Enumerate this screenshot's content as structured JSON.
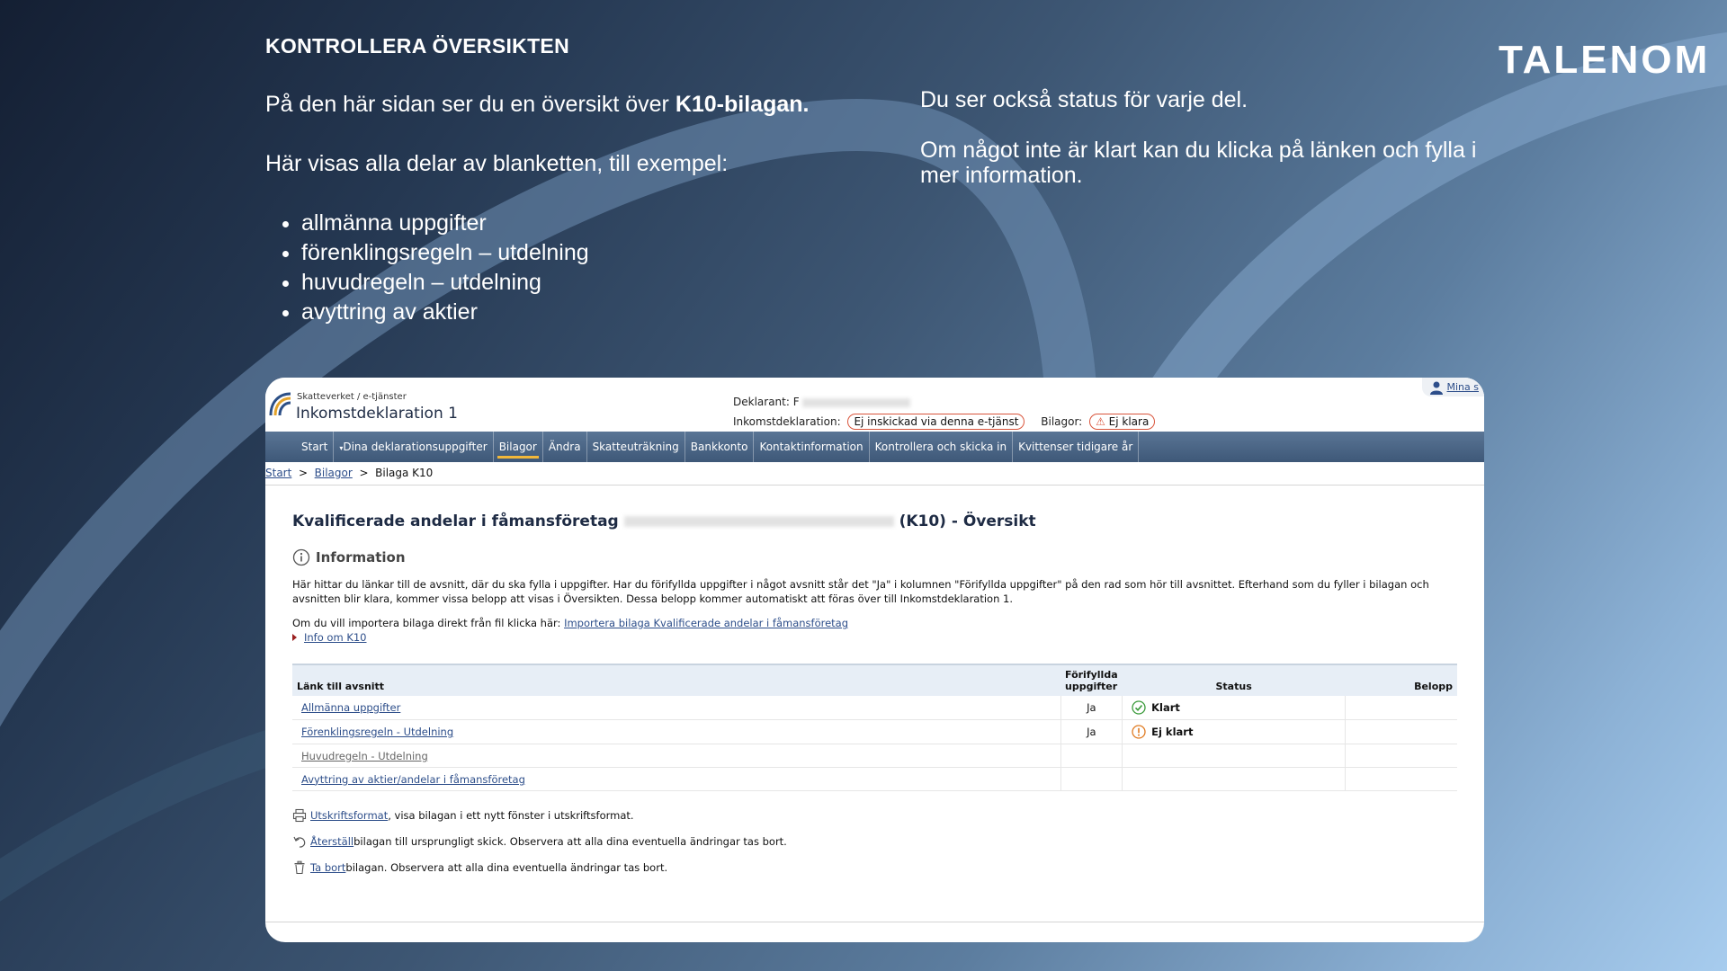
{
  "slide": {
    "title": "KONTROLLERA ÖVERSIKTEN",
    "logo": "TALENOM",
    "intro_prefix": "På den här sidan ser du en översikt över ",
    "intro_bold": "K10-bilagan.",
    "parts_intro": "Här visas alla delar av blanketten, till exempel:",
    "bullets": [
      "allmänna uppgifter",
      "förenklingsregeln – utdelning",
      "huvudregeln – utdelning",
      "avyttring av aktier"
    ],
    "right_p1": "Du ser också status för varje del.",
    "right_p2": "Om något inte är klart kan du klicka på länken och fylla i mer information."
  },
  "app": {
    "agency": "Skatteverket / e-tjänster",
    "title": "Inkomstdeklaration 1",
    "declarant_label": "Deklarant:",
    "declarant_value_visible": "F",
    "income_decl_label": "Inkomstdeklaration:",
    "income_decl_status": "Ej inskickad via denna e-tjänst",
    "attachments_label": "Bilagor:",
    "attachments_status": "Ej klara",
    "user_link": "Mina s",
    "nav": [
      "Start",
      "Dina deklarationsuppgifter",
      "Bilagor",
      "Ändra",
      "Skatteuträkning",
      "Bankkonto",
      "Kontaktinformation",
      "Kontrollera och skicka in",
      "Kvittenser tidigare år"
    ],
    "breadcrumb": [
      "Start",
      "Bilagor",
      "Bilaga K10"
    ],
    "page_title_prefix": "Kvalificerade andelar i fåmansföretag",
    "page_title_suffix": "(K10) - Översikt",
    "info_heading": "Information",
    "info_text": "Här hittar du länkar till de avsnitt, där du ska fylla i uppgifter. Har du förifyllda uppgifter i något avsnitt står det \"Ja\" i kolumnen \"Förifyllda uppgifter\" på den rad som hör till avsnittet. Efterhand som du fyller i bilagan och avsnitten blir klara, kommer vissa belopp att visas i Översikten. Dessa belopp kommer automatiskt att föras över till Inkomstdeklaration 1.",
    "import_prefix": "Om du vill importera bilaga direkt från fil klicka här: ",
    "import_link": "Importera bilaga Kvalificerade andelar i fåmansföretag",
    "info_k10": "Info om K10",
    "table": {
      "headers": [
        "Länk till avsnitt",
        "Förifyllda uppgifter",
        "Status",
        "Belopp"
      ],
      "rows": [
        {
          "link": "Allmänna uppgifter",
          "prefilled": "Ja",
          "status": "Klart",
          "amount": ""
        },
        {
          "link": "Förenklingsregeln - Utdelning",
          "prefilled": "Ja",
          "status": "Ej klart",
          "amount": ""
        },
        {
          "link": "Huvudregeln - Utdelning",
          "prefilled": "",
          "status": "",
          "amount": ""
        },
        {
          "link": "Avyttring av aktier/andelar i fåmansföretag",
          "prefilled": "",
          "status": "",
          "amount": ""
        }
      ]
    },
    "actions": [
      {
        "link": "Utskriftsformat",
        "text": ", visa bilagan i ett nytt fönster i utskriftsformat."
      },
      {
        "link": "Återställ",
        "text": " bilagan till ursprungligt skick. Observera att alla dina eventuella ändringar tas bort."
      },
      {
        "link": "Ta bort",
        "text": " bilagan. Observera att alla dina eventuella ändringar tas bort."
      }
    ]
  },
  "colors": {
    "accent_orange": "#d9553c",
    "nav_blue": "#3e5878",
    "ok_green": "#3a9a3a",
    "warn_orange": "#e07b22"
  }
}
